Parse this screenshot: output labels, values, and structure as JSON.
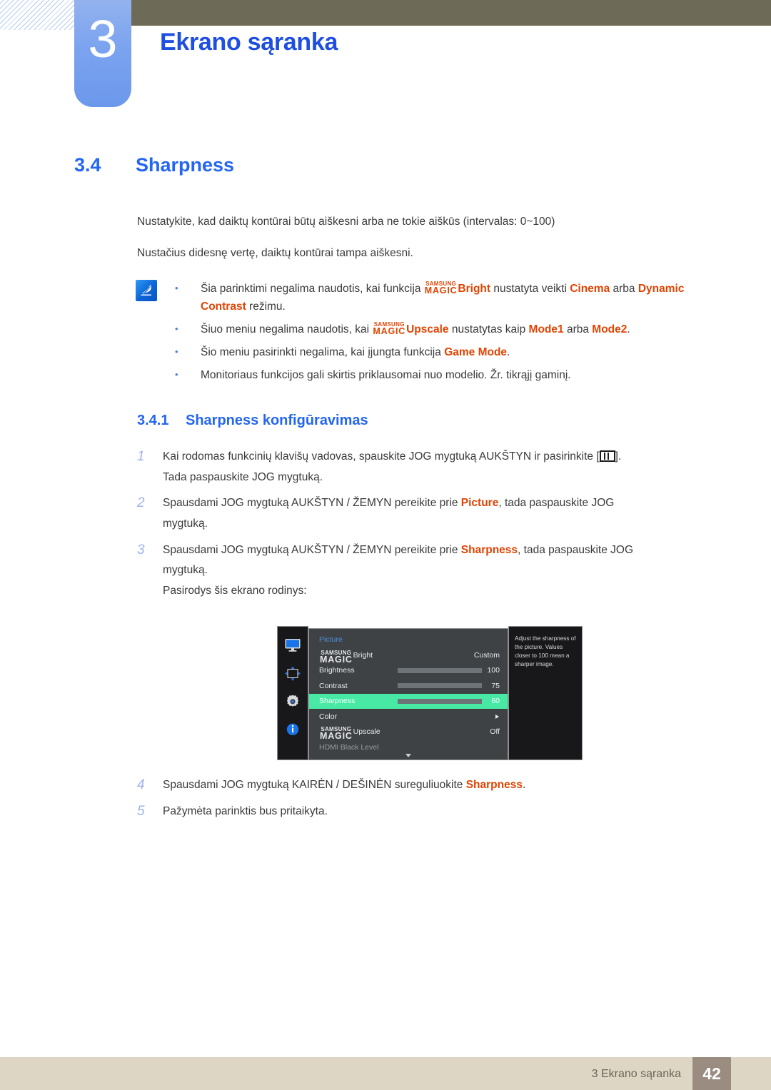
{
  "header": {
    "chapter_number": "3",
    "chapter_title": "Ekrano sąranka"
  },
  "section": {
    "number": "3.4",
    "title": "Sharpness"
  },
  "intro": {
    "paragraph1": "Nustatykite, kad daiktų kontūrai būtų aiškesni arba ne tokie aiškūs (intervalas: 0~100)",
    "paragraph2": "Nustačius didesnę vertę, daiktų kontūrai tampa aiškesni."
  },
  "note": {
    "icon": "note-pen-icon",
    "bullet_marker": "•",
    "items": [
      {
        "pre": "Šia parinktimi negalima naudotis, kai funkcija ",
        "magic_top": "SAMSUNG",
        "magic_bottom": "MAGIC",
        "magic_suffix": "Bright",
        "mid": " nustatyta veikti ",
        "hl1": "Cinema",
        "mid2": " arba ",
        "hl2": "Dynamic Contrast",
        "post": " režimu."
      },
      {
        "pre": "Šiuo meniu negalima naudotis, kai ",
        "magic_top": "SAMSUNG",
        "magic_bottom": "MAGIC",
        "magic_suffix": "Upscale",
        "mid": " nustatytas kaip ",
        "hl1": "Mode1",
        "mid2": " arba ",
        "hl2": "Mode2",
        "post": "."
      },
      {
        "pre": "Šio meniu pasirinkti negalima, kai įjungta funkcija ",
        "hl1": "Game Mode",
        "post": "."
      },
      {
        "pre": "Monitoriaus funkcijos gali skirtis priklausomai nuo modelio. Žr. tikrąjį gaminį."
      }
    ]
  },
  "subsection": {
    "number": "3.4.1",
    "title": "Sharpness konfigūravimas"
  },
  "steps": [
    {
      "num": "1",
      "text_a": "Kai rodomas funkcinių klavišų vadovas, spauskite JOG mygtuką AUKŠTYN ir pasirinkite [",
      "text_b": "].",
      "icon": "menu-bars-icon",
      "sub": "Tada paspauskite JOG mygtuką."
    },
    {
      "num": "2",
      "text_a": "Spausdami JOG mygtuką AUKŠTYN / ŽEMYN pereikite prie ",
      "hl": "Picture",
      "text_b": ", tada paspauskite JOG",
      "sub": "mygtuką."
    },
    {
      "num": "3",
      "text_a": "Spausdami JOG mygtuką AUKŠTYN / ŽEMYN pereikite prie ",
      "hl": "Sharpness",
      "text_b": ", tada paspauskite JOG",
      "sub": "mygtuką.",
      "sub2": "Pasirodys šis ekrano rodinys:"
    },
    {
      "num": "4",
      "text_a": "Spausdami JOG mygtuką KAIRĖN / DEŠINĖN sureguliuokite ",
      "hl": "Sharpness",
      "text_b": "."
    },
    {
      "num": "5",
      "text_a": "Pažymėta parinktis bus pritaikyta."
    }
  ],
  "osd": {
    "menu_title": "Picture",
    "sidebar_icons": [
      "monitor-icon",
      "move-arrows-icon",
      "gear-icon",
      "info-icon"
    ],
    "help_text": "Adjust the sharpness of the picture. Values closer to 100 mean a sharper image.",
    "rows": [
      {
        "magic_top": "SAMSUNG",
        "magic_bottom": "MAGIC",
        "label": "Bright",
        "value": "Custom",
        "slider": null,
        "state": "normal"
      },
      {
        "label": "Brightness",
        "value": "100",
        "slider": 100,
        "state": "normal"
      },
      {
        "label": "Contrast",
        "value": "75",
        "slider": 75,
        "state": "normal"
      },
      {
        "label": "Sharpness",
        "value": "60",
        "slider": 60,
        "state": "selected"
      },
      {
        "label": "Color",
        "value": "",
        "slider": null,
        "state": "submenu"
      },
      {
        "magic_top": "SAMSUNG",
        "magic_bottom": "MAGIC",
        "label": "Upscale",
        "value": "Off",
        "slider": null,
        "state": "normal"
      },
      {
        "label": "HDMI Black Level",
        "value": "",
        "slider": null,
        "state": "dim"
      }
    ],
    "scroll_indicator": "down-arrow-icon"
  },
  "footer": {
    "text": "3 Ekrano sąranka",
    "page": "42"
  },
  "colors": {
    "accent_blue": "#2366f0",
    "highlight_orange": "#e04403",
    "olive_bar": "#6d6b58",
    "footer_bar": "#ddd6c5",
    "page_box": "#9a8c80",
    "osd_selected": "#48e9a5"
  }
}
